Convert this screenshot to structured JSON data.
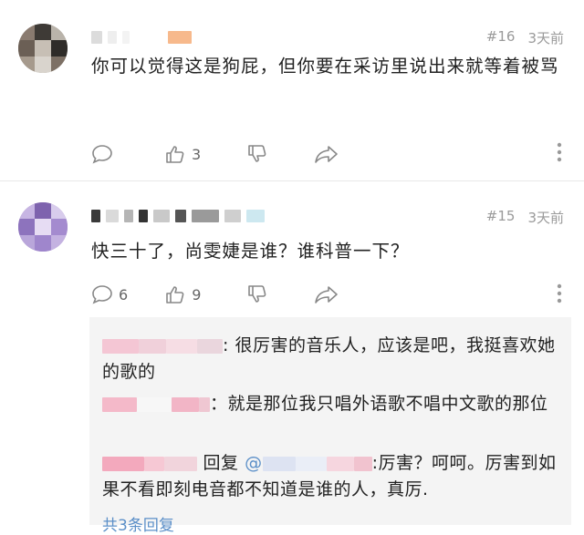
{
  "comments": [
    {
      "floor": "#16",
      "time": "3天前",
      "text": "你可以觉得这是狗屁，但你要在采访里说出来就等着被骂",
      "reply_count": "",
      "like_count": "3"
    },
    {
      "floor": "#15",
      "time": "3天前",
      "text": "快三十了，尚雯婕是谁？谁科普一下？",
      "reply_count": "6",
      "like_count": "9",
      "replies": [
        {
          "text": ": 很厉害的音乐人，应该是吧，我挺喜欢她的歌的"
        },
        {
          "text": "：就是那位我只唱外语歌不唱中文歌的那位"
        },
        {
          "reply_word": "回复",
          "at": "@",
          "text": ":厉害？呵呵。厉害到如果不看即刻电音都不知道是谁的人，真厉."
        }
      ],
      "more_replies": "共3条回复"
    }
  ],
  "icons": {
    "reply": "reply-bubble-icon",
    "like": "thumbs-up-icon",
    "dislike": "thumbs-down-icon",
    "share": "share-arrow-icon",
    "more": "more-vertical-icon"
  },
  "colors": {
    "text": "#222222",
    "meta": "#9a9a9a",
    "link": "#5b8fc8",
    "reply_bg": "#f4f4f4"
  }
}
